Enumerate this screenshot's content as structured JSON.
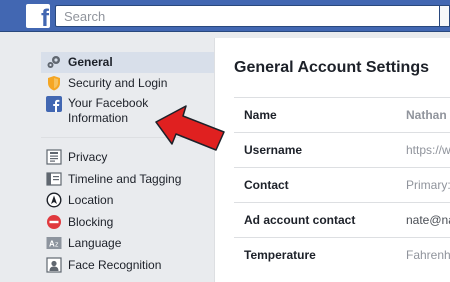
{
  "header": {
    "logo_letter": "f",
    "search_placeholder": "Search",
    "brand_color": "#4267b2"
  },
  "sidebar": {
    "group1": [
      {
        "label": "General",
        "icon": "gear-icon",
        "selected": true
      },
      {
        "label": "Security and Login",
        "icon": "shield-icon",
        "selected": false
      },
      {
        "label": "Your Facebook Information",
        "icon": "facebook-icon",
        "selected": false
      }
    ],
    "group2": [
      {
        "label": "Privacy",
        "icon": "privacy-icon"
      },
      {
        "label": "Timeline and Tagging",
        "icon": "timeline-icon"
      },
      {
        "label": "Location",
        "icon": "location-icon"
      },
      {
        "label": "Blocking",
        "icon": "blocking-icon"
      },
      {
        "label": "Language",
        "icon": "language-icon"
      },
      {
        "label": "Face Recognition",
        "icon": "face-recognition-icon"
      }
    ]
  },
  "main": {
    "title": "General Account Settings",
    "rows": [
      {
        "key": "Name",
        "value": "Nathan W"
      },
      {
        "key": "Username",
        "value": "https://w"
      },
      {
        "key": "Contact",
        "value": "Primary:"
      },
      {
        "key": "Ad account contact",
        "value": "nate@na"
      },
      {
        "key": "Temperature",
        "value": "Fahrenhe"
      }
    ]
  },
  "annotation": {
    "arrow_color": "#e02020",
    "arrow_target": "Your Facebook Information"
  }
}
